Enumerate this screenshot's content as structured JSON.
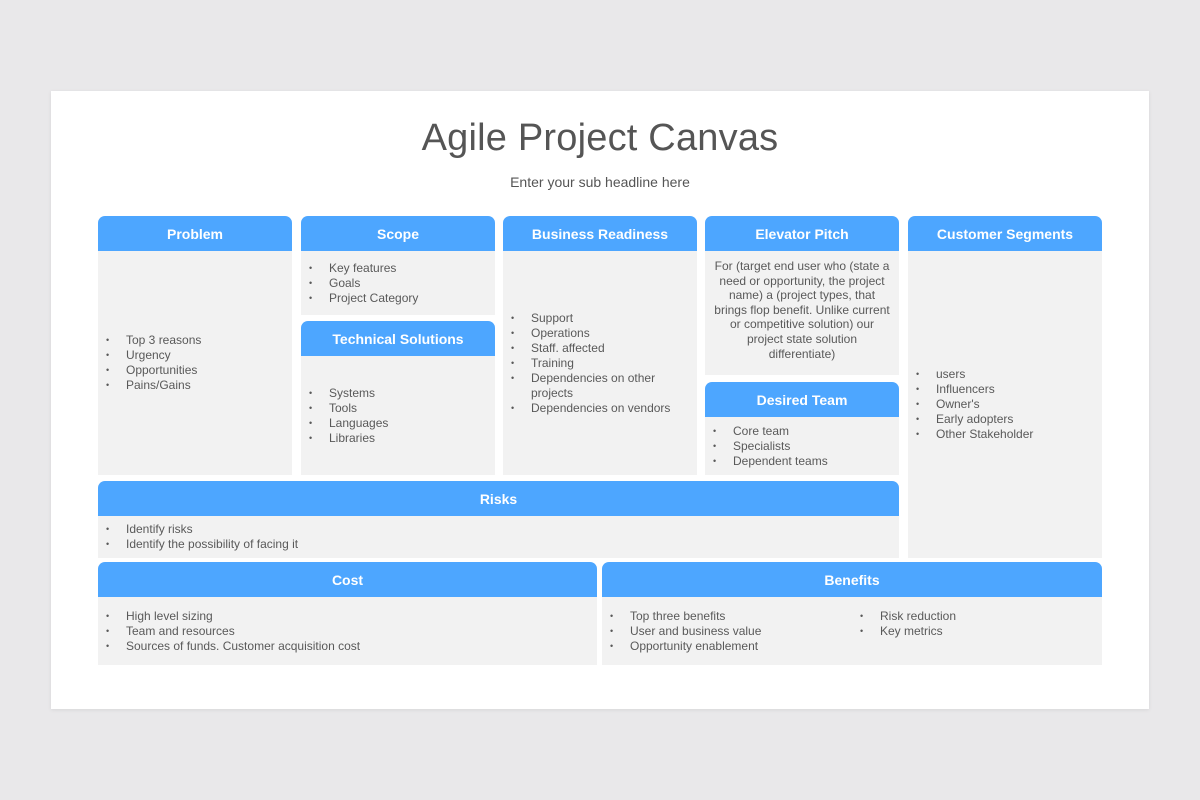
{
  "title": "Agile Project Canvas",
  "subtitle": "Enter your sub headline here",
  "colors": {
    "header": "#4da6ff",
    "body": "#f2f2f2",
    "text": "#595959"
  },
  "problem": {
    "header": "Problem",
    "items": [
      "Top 3 reasons",
      "Urgency",
      "Opportunities",
      "Pains/Gains"
    ]
  },
  "scope": {
    "header": "Scope",
    "items": [
      "Key features",
      "Goals",
      "Project Category"
    ]
  },
  "technical": {
    "header": "Technical Solutions",
    "items": [
      "Systems",
      "Tools",
      "Languages",
      "Libraries"
    ]
  },
  "business": {
    "header": "Business Readiness",
    "items": [
      "Support",
      "Operations",
      "Staff. affected",
      "Training",
      "Dependencies on other projects",
      "Dependencies on vendors"
    ]
  },
  "elevator": {
    "header": "Elevator Pitch",
    "text": "For (target end user who (state a need or opportunity, the project name) a (project types, that brings flop benefit. Unlike current or competitive solution) our project state solution differentiate)"
  },
  "team": {
    "header": "Desired Team",
    "items": [
      "Core team",
      "Specialists",
      "Dependent teams"
    ]
  },
  "customers": {
    "header": "Customer Segments",
    "items": [
      "users",
      "Influencers",
      "Owner's",
      "Early adopters",
      "Other Stakeholder"
    ]
  },
  "risks": {
    "header": "Risks",
    "items": [
      "Identify risks",
      "Identify the possibility of facing it"
    ]
  },
  "cost": {
    "header": "Cost",
    "items": [
      "High level sizing",
      "Team and resources",
      "Sources of funds. Customer acquisition cost"
    ]
  },
  "benefits": {
    "header": "Benefits",
    "items_left": [
      "Top three benefits",
      "User and business value",
      "Opportunity enablement"
    ],
    "items_right": [
      "Risk reduction",
      "Key metrics"
    ]
  }
}
